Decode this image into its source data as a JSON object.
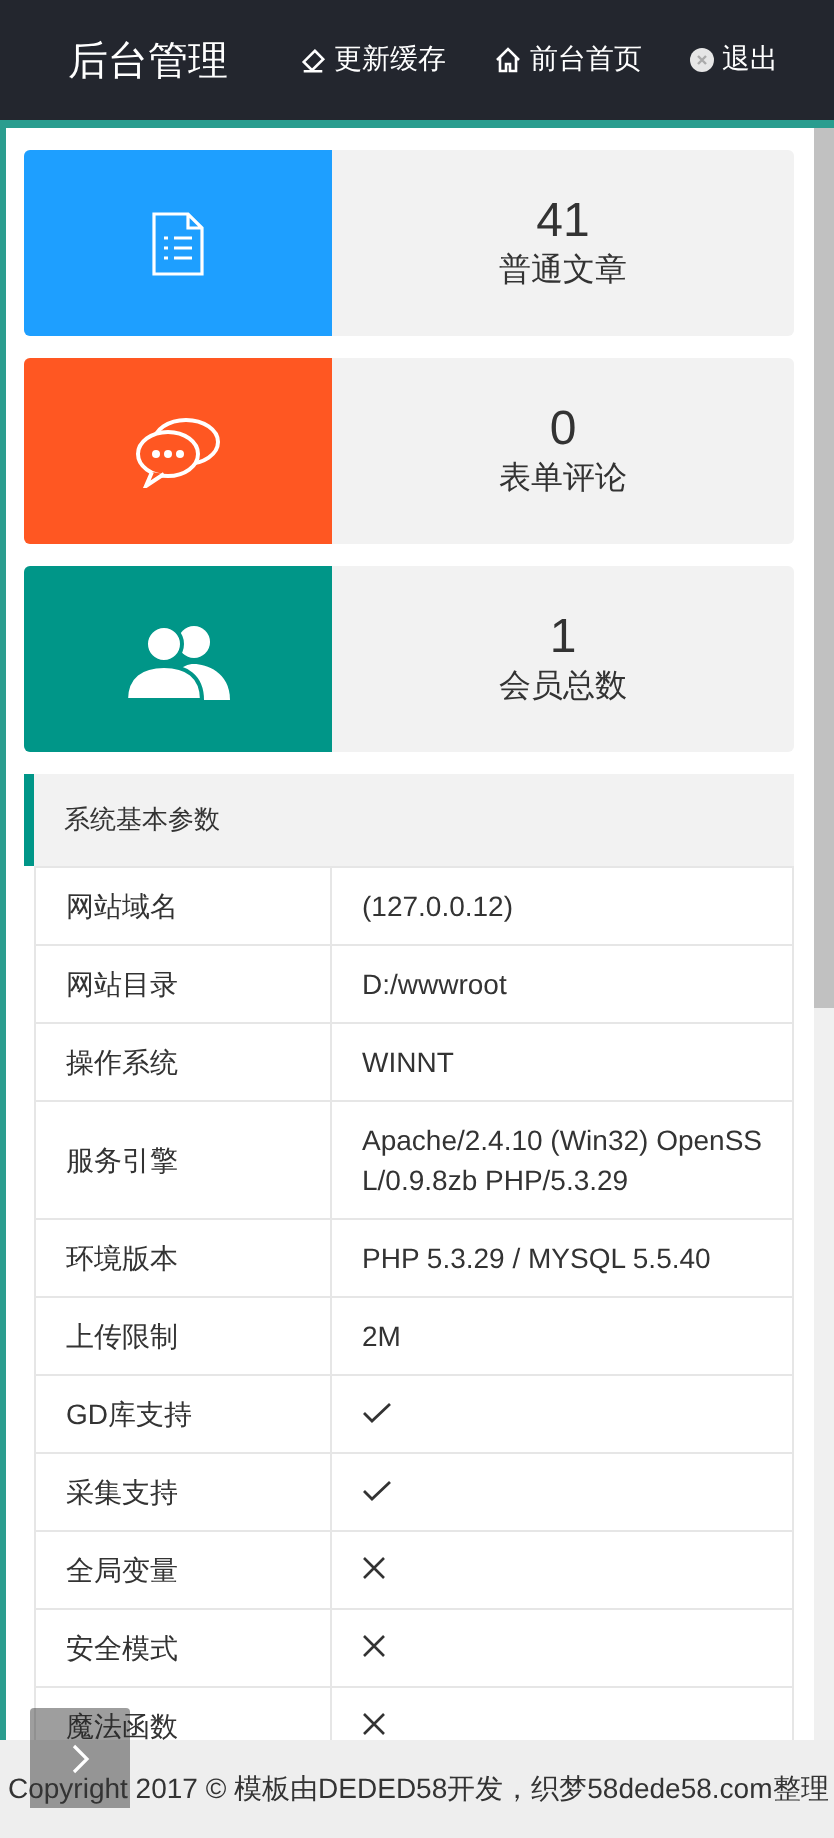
{
  "header": {
    "title": "后台管理",
    "nav": [
      {
        "kind": "eraser",
        "label": "更新缓存"
      },
      {
        "kind": "home",
        "label": "前台首页"
      },
      {
        "kind": "logout",
        "label": "退出"
      }
    ]
  },
  "stats": [
    {
      "kind": "document",
      "color": "#1e9fff",
      "count": "41",
      "label": "普通文章"
    },
    {
      "kind": "comments",
      "color": "#ff5722",
      "count": "0",
      "label": "表单评论"
    },
    {
      "kind": "users",
      "color": "#009688",
      "count": "1",
      "label": "会员总数"
    }
  ],
  "system_table": {
    "title": "系统基本参数",
    "rows": [
      {
        "label": "网站域名",
        "kind": "text",
        "value": "(127.0.0.12)"
      },
      {
        "label": "网站目录",
        "kind": "text",
        "value": "D:/wwwroot"
      },
      {
        "label": "操作系统",
        "kind": "text",
        "value": "WINNT"
      },
      {
        "label": "服务引擎",
        "kind": "text",
        "value": "Apache/2.4.10 (Win32) OpenSSL/0.9.8zb PHP/5.3.29"
      },
      {
        "label": "环境版本",
        "kind": "text",
        "value": "PHP 5.3.29 / MYSQL 5.5.40"
      },
      {
        "label": "上传限制",
        "kind": "text",
        "value": "2M"
      },
      {
        "label": "GD库支持",
        "kind": "status",
        "supported": true
      },
      {
        "label": "采集支持",
        "kind": "status",
        "supported": true
      },
      {
        "label": "全局变量",
        "kind": "status",
        "supported": false
      },
      {
        "label": "安全模式",
        "kind": "status",
        "supported": false
      },
      {
        "label": "魔法函数",
        "kind": "status",
        "supported": false
      }
    ]
  },
  "footer": {
    "text": "Copyright 2017 © 模板由DEDED58开发，织梦58dede58.com整理"
  }
}
